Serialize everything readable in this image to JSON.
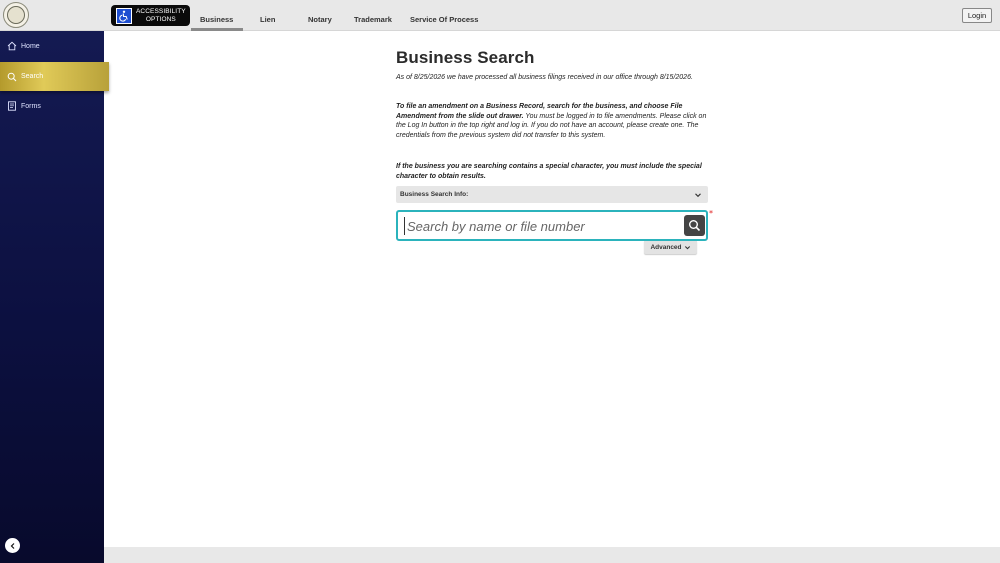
{
  "header": {
    "accessibility_label_line1": "ACCESSIBILITY",
    "accessibility_label_line2": "OPTIONS",
    "tabs": [
      {
        "label": "Business",
        "active": true
      },
      {
        "label": "Lien",
        "active": false
      },
      {
        "label": "Notary",
        "active": false
      },
      {
        "label": "Trademark",
        "active": false
      },
      {
        "label": "Service Of Process",
        "active": false
      }
    ],
    "login_label": "Login"
  },
  "sidebar": {
    "items": [
      {
        "label": "Home",
        "icon": "home-icon",
        "active": false
      },
      {
        "label": "Search",
        "icon": "search-icon",
        "active": true
      },
      {
        "label": "Forms",
        "icon": "forms-icon",
        "active": false
      }
    ],
    "collapse_icon": "chevron-left-icon"
  },
  "main": {
    "title": "Business Search",
    "processed_notice": "As of 8/25/2026 we have processed all business filings received in our office through 8/15/2026.",
    "amendment_bold": "To file an amendment on a Business Record, search for the business, and choose File Amendment from the slide out drawer.",
    "amendment_rest": " You must be logged in to file amendments. Please click on the Log In button in the top right and log in. If you do not have an account, please create one. The credentials from the previous system did not transfer to this system.",
    "special_char_notice": "If the business you are searching contains a special character, you must include the special character to obtain results.",
    "info_dropdown_label": "Business Search Info:",
    "search_placeholder": "Search by name or file number",
    "search_value": "",
    "required_marker": "*",
    "advanced_label": "Advanced"
  },
  "colors": {
    "sidebar_bg": "#0c1040",
    "active_gold": "#d4bd4a",
    "search_border": "#2bb3bc",
    "search_button": "#444444",
    "required": "#e02020"
  }
}
